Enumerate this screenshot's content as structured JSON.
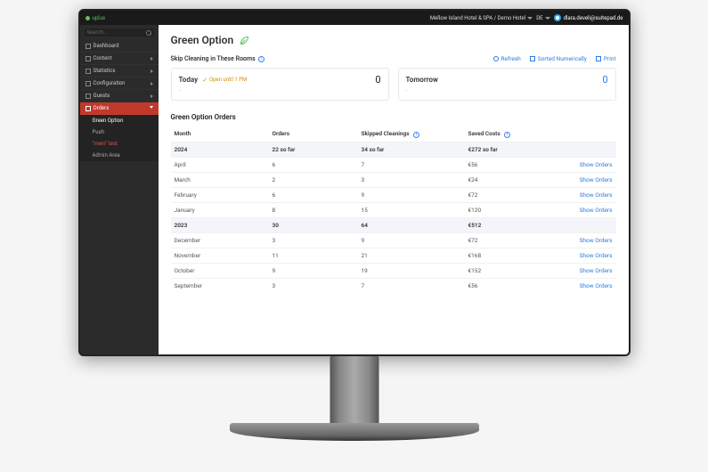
{
  "topbar": {
    "brand": "uplus",
    "hotel_path": "Mellow Island Hotel & SPA / Demo Hotel",
    "lang": "DE",
    "user_email": "dlara.develi@suitepad.de"
  },
  "sidebar": {
    "search_placeholder": "Search...",
    "items": [
      {
        "label": "Dashboard"
      },
      {
        "label": "Content"
      },
      {
        "label": "Statistics"
      },
      {
        "label": "Configuration"
      },
      {
        "label": "Guests"
      },
      {
        "label": "Orders",
        "active": true,
        "sub": [
          {
            "label": "Green Option",
            "selected": true
          },
          {
            "label": "Push"
          },
          {
            "label": "\"mein\" test",
            "warn": true
          },
          {
            "label": "Admin Area"
          }
        ]
      }
    ]
  },
  "page": {
    "title": "Green Option",
    "skip_section_title": "Skip Cleaning in These Rooms",
    "actions": {
      "refresh": "Refresh",
      "sort": "Sorted Numerically",
      "print": "Print"
    },
    "cards": {
      "today": {
        "title": "Today",
        "open_label": "Open until 1 PM",
        "count": "0",
        "dash": "-"
      },
      "tomorrow": {
        "title": "Tomorrow",
        "count": "0",
        "dash": "-"
      }
    },
    "orders_title": "Green Option Orders",
    "table": {
      "headers": {
        "month": "Month",
        "orders": "Orders",
        "skip": "Skipped Cleanings",
        "cost": "Saved Costs"
      },
      "show_orders": "Show Orders",
      "rows": [
        {
          "month": "2024",
          "orders": "22 so far",
          "skip": "34 so far",
          "cost": "€272 so far",
          "year": true
        },
        {
          "month": "April",
          "orders": "6",
          "skip": "7",
          "cost": "€56"
        },
        {
          "month": "March",
          "orders": "2",
          "skip": "3",
          "cost": "€24"
        },
        {
          "month": "February",
          "orders": "6",
          "skip": "9",
          "cost": "€72"
        },
        {
          "month": "January",
          "orders": "8",
          "skip": "15",
          "cost": "€120"
        },
        {
          "month": "2023",
          "orders": "30",
          "skip": "64",
          "cost": "€512",
          "year": true
        },
        {
          "month": "December",
          "orders": "3",
          "skip": "9",
          "cost": "€72"
        },
        {
          "month": "November",
          "orders": "11",
          "skip": "21",
          "cost": "€168"
        },
        {
          "month": "October",
          "orders": "9",
          "skip": "19",
          "cost": "€152"
        },
        {
          "month": "September",
          "orders": "3",
          "skip": "7",
          "cost": "€56"
        }
      ]
    }
  }
}
